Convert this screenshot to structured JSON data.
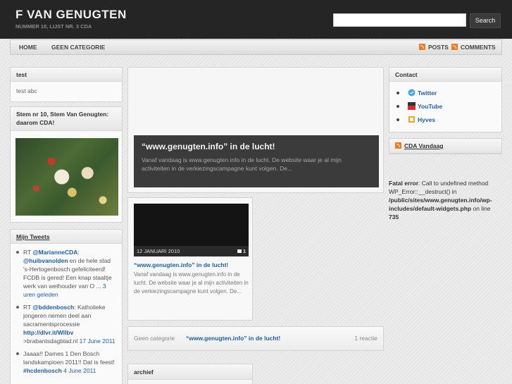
{
  "header": {
    "title": "F VAN GENUGTEN",
    "subtitle": "NUMMER 10, LIJST NR. 3 CDA",
    "search_button": "Search"
  },
  "nav": {
    "home": "HOME",
    "category": "GEEN CATEGORIE",
    "posts": "POSTS",
    "comments": "COMMENTS"
  },
  "left": {
    "test_title": "test",
    "test_body": "test abc",
    "stem_title": "Stem nr 10, Stem Van Genugten: daarom CDA!",
    "tweets_title": "Mijn Tweets",
    "tweets": [
      {
        "a": "RT ",
        "b": "@MarianneCDA",
        "c": ": ",
        "d": "@huibvanolden",
        "e": " en de hele stad 's-Hertogenbosch gefeliciteerd! FCDB is gered! Een knap staaltje werk van wethouder van O ... ",
        "f": "3 uren geleden"
      },
      {
        "a": "RT ",
        "b": "@bddenbosch",
        "c": ": Katholieke jongeren nemen deel aan sacramentsprocessie ",
        "d": "http://dlvr.it/Wllbv",
        "e": " >brabantsdagblad.nl ",
        "f": "17 June 2011"
      },
      {
        "a": "Jaaaa!! Dames 1 Den Bosch landskampioen 2011!! Dat is feest! ",
        "b": "#hcdenbosch",
        "c": " ",
        "d": "4 June 2011"
      }
    ]
  },
  "featured": {
    "title": "“www.genugten.info” in de lucht!",
    "excerpt": "Vanaf vandaag is www.genugten.info in de lucht. De website waar je al mijn activiteiten in de verkiezingscampagne kunt volgen. De..."
  },
  "card": {
    "date": "12 JANUARI 2010",
    "comments": "1",
    "title": "“www.genugten.info” in de lucht!",
    "excerpt": "Vanaf vandaag is www.genugten.info in de lucht. De website waar je al mijn activiteiten in de verkiezingscampagne kunt volgen. De..."
  },
  "postbar": {
    "category": "Geen categorie",
    "title": "“www.genugten.info” in de lucht!",
    "reactions": "1 reactie"
  },
  "archief": {
    "title": "archief"
  },
  "right": {
    "contact_title": "Contact",
    "contacts": [
      "Twitter",
      "YouTube",
      "Hyves"
    ],
    "cda_title": "CDA Vandaag",
    "error_label": "Fatal error",
    "error_text": ": Call to undefined method WP_Error::__destruct() in ",
    "error_path": "/public/sites/www.genugten.info/wp-includes/default-widgets.php",
    "error_online": " on line ",
    "error_line": "735"
  },
  "colors": {
    "link": "#1f5fa8",
    "header_bg": "#252525",
    "rss": "#f07a1e"
  }
}
